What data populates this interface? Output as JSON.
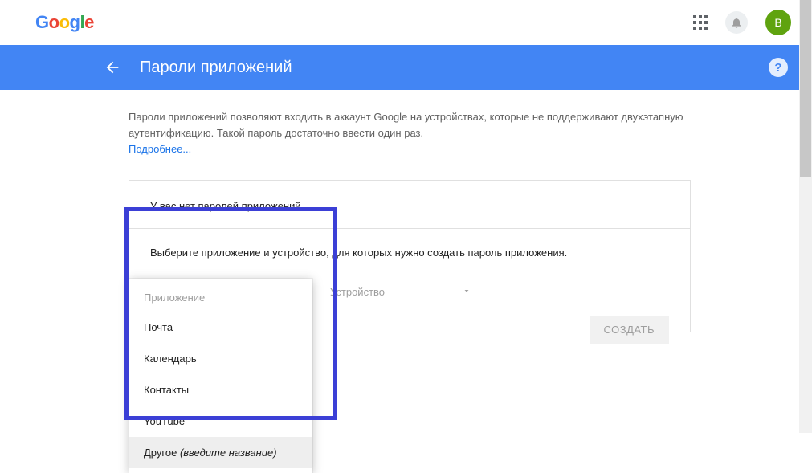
{
  "topbar": {
    "logo_letters": [
      "G",
      "o",
      "o",
      "g",
      "l",
      "e"
    ],
    "avatar_initial": "B"
  },
  "header": {
    "title": "Пароли приложений"
  },
  "intro": {
    "text": "Пароли приложений позволяют входить в аккаунт Google на устройствах, которые не поддерживают двухэтапную аутентификацию. Такой пароль достаточно ввести один раз.",
    "learn_more": "Подробнее..."
  },
  "card": {
    "no_passwords": "У вас нет паролей приложений.",
    "choose_text": "Выберите приложение и устройство, для которых нужно создать пароль приложения.",
    "app_placeholder": "Приложение",
    "device_placeholder": "Устройство",
    "create_button": "СОЗДАТЬ"
  },
  "menu": {
    "header": "Приложение",
    "items": [
      {
        "label": "Почта"
      },
      {
        "label": "Календарь"
      },
      {
        "label": "Контакты"
      },
      {
        "label": "YouTube"
      }
    ],
    "other_label": "Другое",
    "other_hint": "(введите название)"
  }
}
